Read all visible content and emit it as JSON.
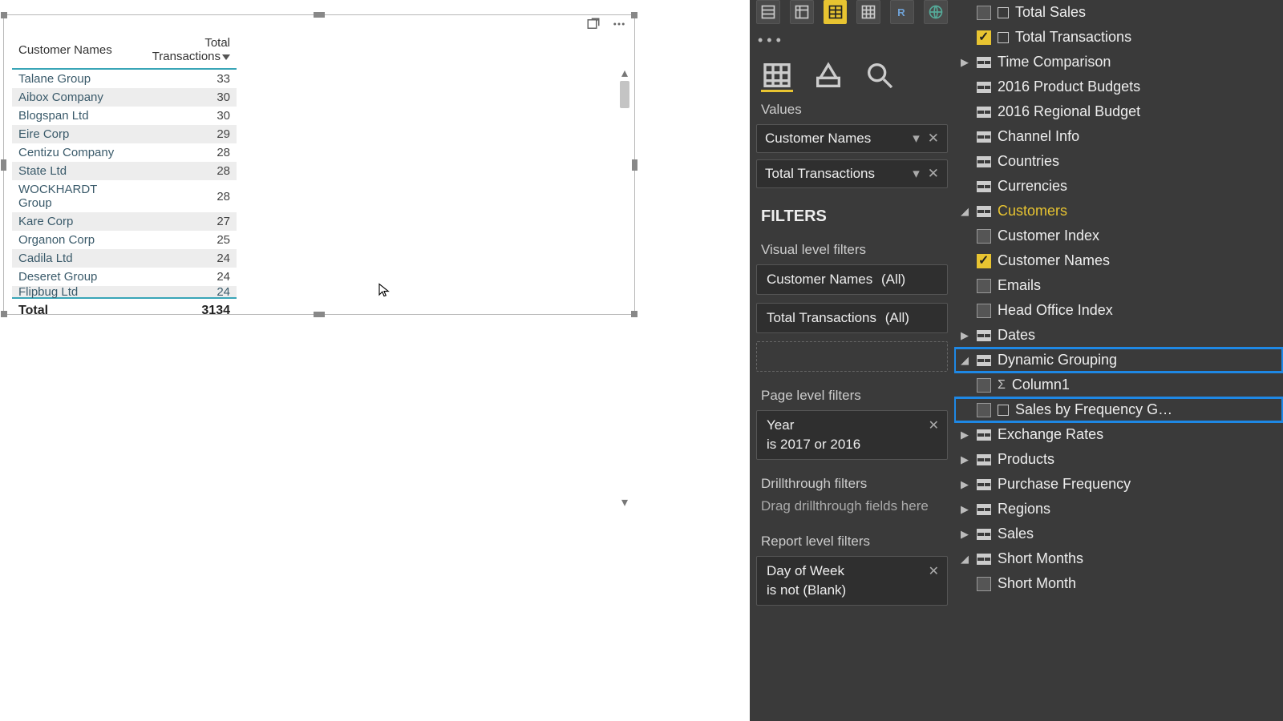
{
  "table": {
    "columns": {
      "c1": "Customer Names",
      "c2": "Total Transactions"
    },
    "rows": [
      {
        "name": "Talane Group",
        "val": "33"
      },
      {
        "name": "Aibox Company",
        "val": "30"
      },
      {
        "name": "Blogspan Ltd",
        "val": "30"
      },
      {
        "name": "Eire Corp",
        "val": "29"
      },
      {
        "name": "Centizu Company",
        "val": "28"
      },
      {
        "name": "State Ltd",
        "val": "28"
      },
      {
        "name": "WOCKHARDT Group",
        "val": "28"
      },
      {
        "name": "Kare Corp",
        "val": "27"
      },
      {
        "name": "Organon Corp",
        "val": "25"
      },
      {
        "name": "Cadila Ltd",
        "val": "24"
      },
      {
        "name": "Deseret Group",
        "val": "24"
      },
      {
        "name": "Flipbug Ltd",
        "val": "24"
      }
    ],
    "total_label": "Total",
    "total_value": "3134"
  },
  "viz": {
    "values_label": "Values",
    "value_fields": {
      "f1": "Customer Names",
      "f2": "Total Transactions"
    },
    "filters_title": "FILTERS",
    "visual_filters_label": "Visual level filters",
    "vf1_name": "Customer Names",
    "vf1_scope": "(All)",
    "vf2_name": "Total Transactions",
    "vf2_scope": "(All)",
    "page_filters_label": "Page level filters",
    "pf_name": "Year",
    "pf_cond": "is 2017 or 2016",
    "drill_label": "Drillthrough filters",
    "drill_hint": "Drag drillthrough fields here",
    "report_filters_label": "Report level filters",
    "rf_name": "Day of Week",
    "rf_cond": "is not (Blank)"
  },
  "fields": {
    "top": {
      "a": "Total Sales",
      "b": "Total Transactions"
    },
    "tables": {
      "time_comparison": "Time Comparison",
      "prod_budgets": "2016 Product Budgets",
      "reg_budget": "2016 Regional Budget",
      "channel": "Channel Info",
      "countries": "Countries",
      "currencies": "Currencies",
      "customers": "Customers",
      "cust_idx": "Customer Index",
      "cust_names": "Customer Names",
      "emails": "Emails",
      "head_office": "Head Office Index",
      "dates": "Dates",
      "dyn_group": "Dynamic Grouping",
      "col1": "Column1",
      "sales_freq": "Sales by Frequency G…",
      "exch": "Exchange Rates",
      "products": "Products",
      "purch_freq": "Purchase Frequency",
      "regions": "Regions",
      "sales": "Sales",
      "short_months": "Short Months",
      "short_month": "Short Month"
    }
  }
}
